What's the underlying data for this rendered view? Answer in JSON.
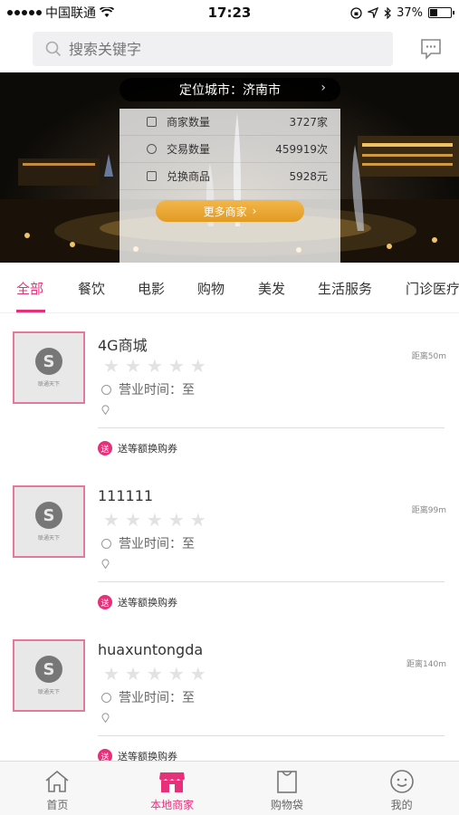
{
  "status": {
    "carrier": "中国联通",
    "time": "17:23",
    "battery": "37%",
    "battery_level": 0.37
  },
  "search": {
    "placeholder": "搜索关键字"
  },
  "banner": {
    "city_label": "定位城市：济南市",
    "stats": [
      {
        "label": "商家数量",
        "value": "3727家"
      },
      {
        "label": "交易数量",
        "value": "459919次"
      },
      {
        "label": "兑换商品",
        "value": "5928元"
      }
    ],
    "more_button": "更多商家"
  },
  "tabs": [
    "全部",
    "餐饮",
    "电影",
    "购物",
    "美发",
    "生活服务",
    "门诊医疗"
  ],
  "merchants": [
    {
      "name": "4G商城",
      "distance": "距离50m",
      "hours": "营业时间：至",
      "coupon_badge": "送",
      "coupon": "送等额换购券",
      "rating": 0
    },
    {
      "name": "111111",
      "distance": "距离99m",
      "hours": "营业时间：至",
      "coupon_badge": "送",
      "coupon": "送等额换购券",
      "rating": 0
    },
    {
      "name": "huaxuntongda",
      "distance": "距离140m",
      "hours": "营业时间：至",
      "coupon_badge": "送",
      "coupon": "送等额换购券",
      "rating": 0
    }
  ],
  "thumb": {
    "brand": "联通天下"
  },
  "nav": [
    {
      "label": "首页",
      "icon": "home-icon"
    },
    {
      "label": "本地商家",
      "icon": "store-icon"
    },
    {
      "label": "购物袋",
      "icon": "bag-icon"
    },
    {
      "label": "我的",
      "icon": "profile-icon"
    }
  ],
  "colors": {
    "accent": "#e6307a",
    "button": "#e9a530"
  }
}
